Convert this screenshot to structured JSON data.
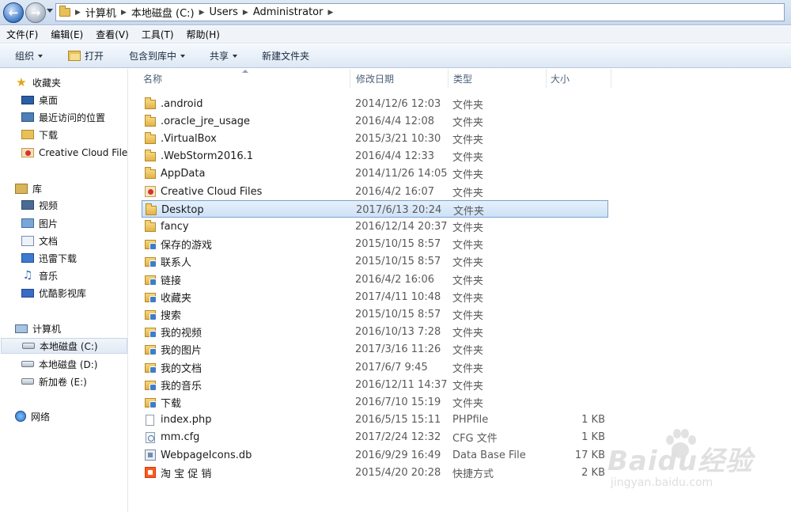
{
  "address": {
    "crumbs": [
      "计算机",
      "本地磁盘 (C:)",
      "Users",
      "Administrator"
    ]
  },
  "menu": [
    "文件(F)",
    "编辑(E)",
    "查看(V)",
    "工具(T)",
    "帮助(H)"
  ],
  "toolbar": {
    "organize": "组织",
    "open": "打开",
    "include_in_library": "包含到库中",
    "share": "共享",
    "new_folder": "新建文件夹"
  },
  "nav": {
    "favorites": {
      "label": "收藏夹",
      "items": [
        "桌面",
        "最近访问的位置",
        "下载",
        "Creative Cloud Files"
      ]
    },
    "libraries": {
      "label": "库",
      "items": [
        "视频",
        "图片",
        "文档",
        "迅雷下载",
        "音乐",
        "优酷影视库"
      ]
    },
    "computer": {
      "label": "计算机",
      "items": [
        "本地磁盘 (C:)",
        "本地磁盘 (D:)",
        "新加卷 (E:)"
      ]
    },
    "network": {
      "label": "网络"
    }
  },
  "columns": {
    "name": "名称",
    "modified": "修改日期",
    "type": "类型",
    "size": "大小"
  },
  "files": [
    {
      "name": ".android",
      "date": "2014/12/6 12:03",
      "type": "文件夹",
      "size": "",
      "icon": "folder-icon"
    },
    {
      "name": ".oracle_jre_usage",
      "date": "2016/4/4 12:08",
      "type": "文件夹",
      "size": "",
      "icon": "folder-icon"
    },
    {
      "name": ".VirtualBox",
      "date": "2015/3/21 10:30",
      "type": "文件夹",
      "size": "",
      "icon": "folder-icon"
    },
    {
      "name": ".WebStorm2016.1",
      "date": "2016/4/4 12:33",
      "type": "文件夹",
      "size": "",
      "icon": "folder-icon"
    },
    {
      "name": "AppData",
      "date": "2014/11/26 14:05",
      "type": "文件夹",
      "size": "",
      "icon": "folder-icon"
    },
    {
      "name": "Creative Cloud Files",
      "date": "2016/4/2 16:07",
      "type": "文件夹",
      "size": "",
      "icon": "creative-cloud-folder-icon"
    },
    {
      "name": "Desktop",
      "date": "2017/6/13 20:24",
      "type": "文件夹",
      "size": "",
      "icon": "folder-icon",
      "selected": true
    },
    {
      "name": "fancy",
      "date": "2016/12/14 20:37",
      "type": "文件夹",
      "size": "",
      "icon": "folder-icon"
    },
    {
      "name": "保存的游戏",
      "date": "2015/10/15 8:57",
      "type": "文件夹",
      "size": "",
      "icon": "saved-games-icon"
    },
    {
      "name": "联系人",
      "date": "2015/10/15 8:57",
      "type": "文件夹",
      "size": "",
      "icon": "contacts-icon"
    },
    {
      "name": "链接",
      "date": "2016/4/2 16:06",
      "type": "文件夹",
      "size": "",
      "icon": "links-icon"
    },
    {
      "name": "收藏夹",
      "date": "2017/4/11 10:48",
      "type": "文件夹",
      "size": "",
      "icon": "favorites-folder-icon"
    },
    {
      "name": "搜索",
      "date": "2015/10/15 8:57",
      "type": "文件夹",
      "size": "",
      "icon": "searches-icon"
    },
    {
      "name": "我的视频",
      "date": "2016/10/13 7:28",
      "type": "文件夹",
      "size": "",
      "icon": "my-videos-icon"
    },
    {
      "name": "我的图片",
      "date": "2017/3/16 11:26",
      "type": "文件夹",
      "size": "",
      "icon": "my-pictures-icon"
    },
    {
      "name": "我的文档",
      "date": "2017/6/7 9:45",
      "type": "文件夹",
      "size": "",
      "icon": "my-documents-icon"
    },
    {
      "name": "我的音乐",
      "date": "2016/12/11 14:37",
      "type": "文件夹",
      "size": "",
      "icon": "my-music-icon"
    },
    {
      "name": "下载",
      "date": "2016/7/10 15:19",
      "type": "文件夹",
      "size": "",
      "icon": "downloads-icon"
    },
    {
      "name": "index.php",
      "date": "2016/5/15 15:11",
      "type": "PHPfile",
      "size": "1 KB",
      "icon": "php-file-icon"
    },
    {
      "name": "mm.cfg",
      "date": "2017/2/24 12:32",
      "type": "CFG 文件",
      "size": "1 KB",
      "icon": "cfg-file-icon"
    },
    {
      "name": "WebpageIcons.db",
      "date": "2016/9/29 16:49",
      "type": "Data Base File",
      "size": "17 KB",
      "icon": "database-file-icon"
    },
    {
      "name": "淘 宝 促 销",
      "date": "2015/4/20 20:28",
      "type": "快捷方式",
      "size": "2 KB",
      "icon": "taobao-shortcut-icon"
    }
  ],
  "watermark": {
    "logo": "Baidu经验",
    "url": "jingyan.baidu.com"
  }
}
